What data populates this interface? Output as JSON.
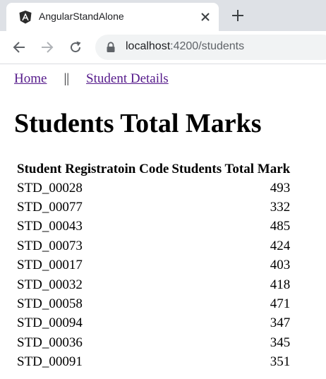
{
  "browser": {
    "tab_title": "AngularStandAlone",
    "url_host": "localhost",
    "url_path": ":4200/students"
  },
  "nav": {
    "home": "Home",
    "separator": "||",
    "student_details": "Student Details"
  },
  "heading": "Students Total Marks",
  "table": {
    "headers": [
      "Student Registratoin Code",
      "Students Total Mark"
    ],
    "rows": [
      {
        "code": "STD_00028",
        "mark": "493"
      },
      {
        "code": "STD_00077",
        "mark": "332"
      },
      {
        "code": "STD_00043",
        "mark": "485"
      },
      {
        "code": "STD_00073",
        "mark": "424"
      },
      {
        "code": "STD_00017",
        "mark": "403"
      },
      {
        "code": "STD_00032",
        "mark": "418"
      },
      {
        "code": "STD_00058",
        "mark": "471"
      },
      {
        "code": "STD_00094",
        "mark": "347"
      },
      {
        "code": "STD_00036",
        "mark": "345"
      },
      {
        "code": "STD_00091",
        "mark": "351"
      }
    ]
  }
}
